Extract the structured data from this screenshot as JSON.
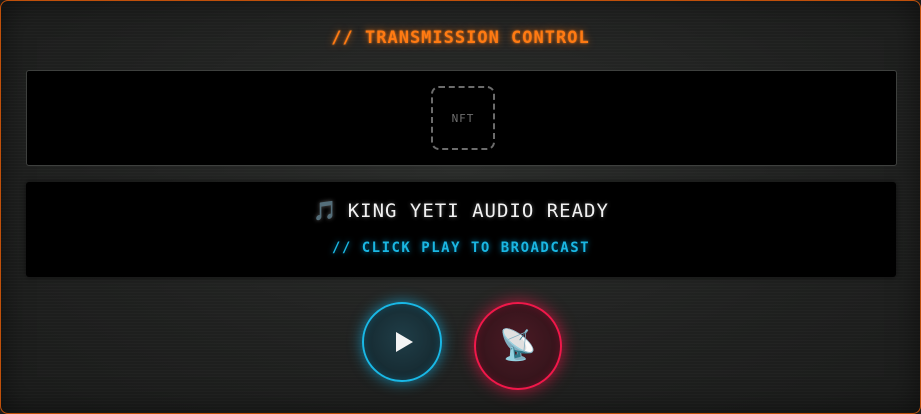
{
  "header": {
    "title": "// TRANSMISSION CONTROL"
  },
  "nft": {
    "placeholder_label": "NFT"
  },
  "status": {
    "icon": "music-note-icon",
    "icon_glyph": "🎵",
    "message": "KING YETI AUDIO READY",
    "hint": "// CLICK PLAY TO BROADCAST"
  },
  "controls": {
    "play": {
      "icon": "play-icon",
      "color": "#19b8e6"
    },
    "broadcast": {
      "icon": "satellite-dish-icon",
      "glyph": "📡",
      "color": "#f0184a"
    }
  },
  "colors": {
    "accent_orange": "#ff7a12",
    "accent_cyan": "#1ab7e3",
    "accent_red": "#f0184a"
  }
}
